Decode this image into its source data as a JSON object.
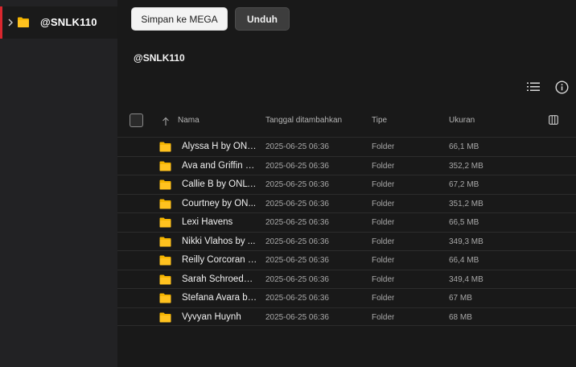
{
  "sidebar": {
    "tree_item": {
      "label": "@SNLK110"
    }
  },
  "toolbar": {
    "save_label": "Simpan ke MEGA",
    "download_label": "Unduh"
  },
  "breadcrumb": {
    "title": "@SNLK110"
  },
  "table": {
    "columns": {
      "name": "Nama",
      "date_added": "Tanggal ditambahkan",
      "type": "Tipe",
      "size": "Ukuran"
    },
    "rows": [
      {
        "name": "Alyssa H by ONL...",
        "date": "2025-06-25 06:36",
        "type": "Folder",
        "size": "66,1 MB"
      },
      {
        "name": "Ava and Griffin b...",
        "date": "2025-06-25 06:36",
        "type": "Folder",
        "size": "352,2 MB"
      },
      {
        "name": "Callie B by ONLY...",
        "date": "2025-06-25 06:36",
        "type": "Folder",
        "size": "67,2 MB"
      },
      {
        "name": "Courtney by ON...",
        "date": "2025-06-25 06:36",
        "type": "Folder",
        "size": "351,2 MB"
      },
      {
        "name": "Lexi Havens",
        "date": "2025-06-25 06:36",
        "type": "Folder",
        "size": "66,5 MB"
      },
      {
        "name": "Nikki Vlahos by ...",
        "date": "2025-06-25 06:36",
        "type": "Folder",
        "size": "349,3 MB"
      },
      {
        "name": "Reilly Corcoran b...",
        "date": "2025-06-25 06:36",
        "type": "Folder",
        "size": "66,4 MB"
      },
      {
        "name": "Sarah Schroeder...",
        "date": "2025-06-25 06:36",
        "type": "Folder",
        "size": "349,4 MB"
      },
      {
        "name": "Stefana Avara by...",
        "date": "2025-06-25 06:36",
        "type": "Folder",
        "size": "67 MB"
      },
      {
        "name": "Vyvyan Huynh",
        "date": "2025-06-25 06:36",
        "type": "Folder",
        "size": "68 MB"
      }
    ]
  },
  "icons": {
    "folder": "folder-icon",
    "chevron": "chevron-right-icon",
    "list_view": "list-view-icon",
    "info": "info-icon",
    "sort": "sort-up-arrow-icon",
    "columns": "columns-icon"
  },
  "colors": {
    "accent": "#d9272e",
    "folder": "#f4b400",
    "background": "#191919",
    "sidebar": "#222224"
  }
}
